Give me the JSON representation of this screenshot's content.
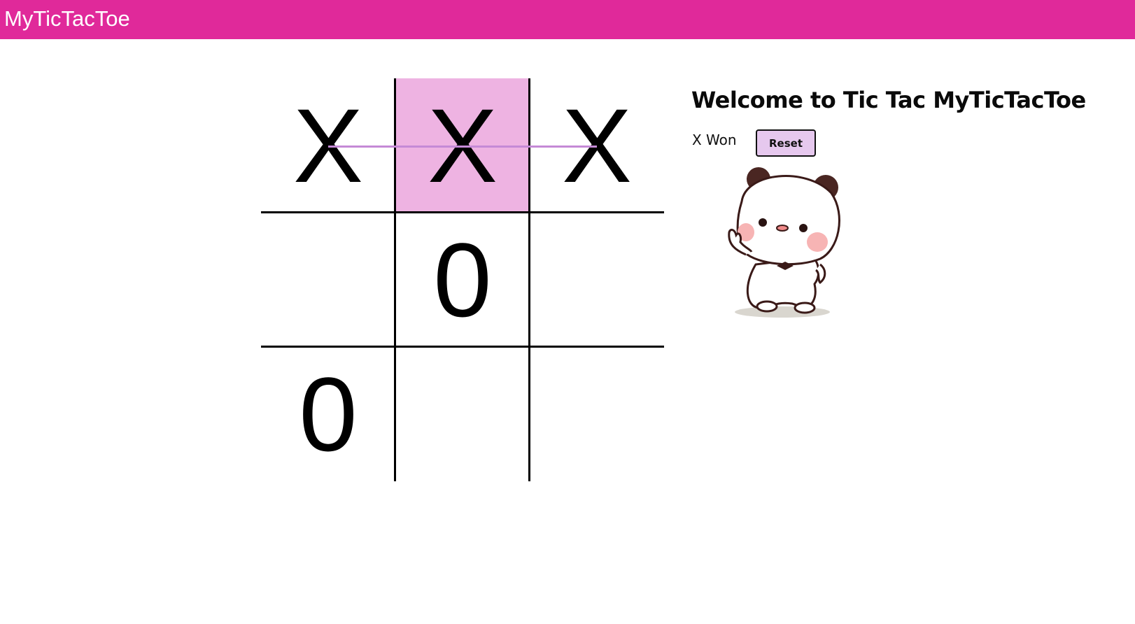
{
  "app": {
    "title": "MyTicTacToe",
    "accent_color": "#e0299a",
    "highlight_color": "#eeb3e2",
    "win_line_color": "#c58ad6"
  },
  "board": {
    "cells": [
      {
        "value": "X",
        "highlight": false
      },
      {
        "value": "X",
        "highlight": true
      },
      {
        "value": "X",
        "highlight": false
      },
      {
        "value": "",
        "highlight": false
      },
      {
        "value": "0",
        "highlight": false
      },
      {
        "value": "",
        "highlight": false
      },
      {
        "value": "0",
        "highlight": false
      },
      {
        "value": "",
        "highlight": false
      },
      {
        "value": "",
        "highlight": false
      }
    ],
    "winning_row": 0
  },
  "sidebar": {
    "welcome": "Welcome to Tic Tac MyTicTacToe",
    "status": "X Won",
    "reset_label": "Reset",
    "mascot_icon": "panda-mascot-icon"
  }
}
